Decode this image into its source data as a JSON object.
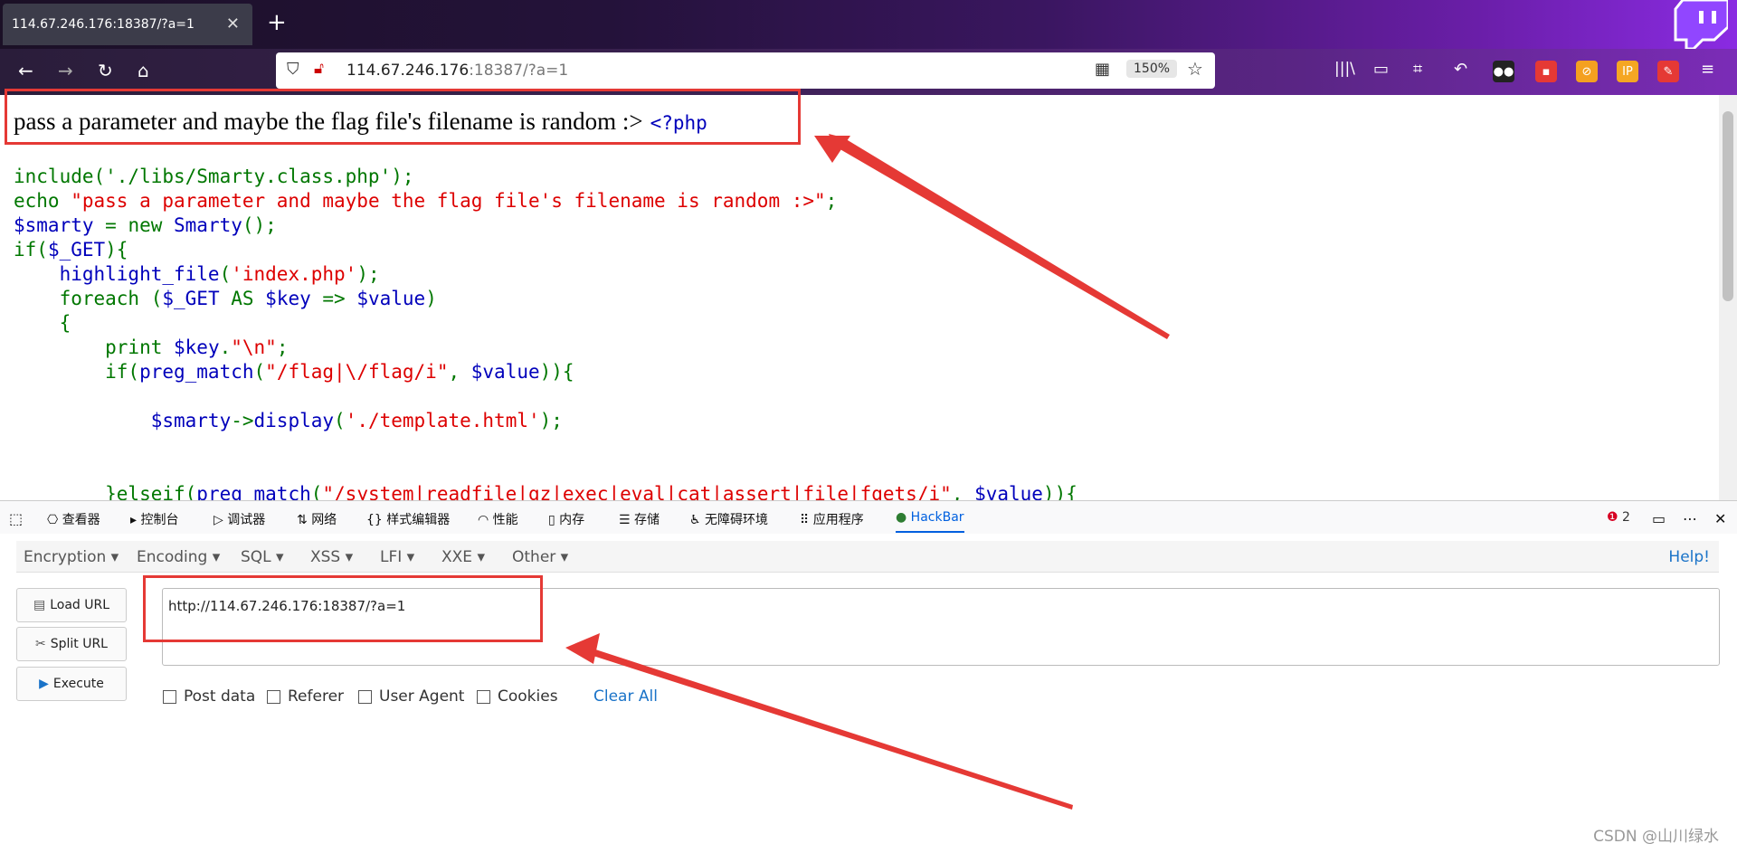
{
  "browser": {
    "tab_title": "114.67.246.176:18387/?a=1",
    "tab_close": "✕",
    "new_tab": "+",
    "url_host": "114.67.246.176",
    "url_rest": ":18387/?a=1",
    "zoom": "150%"
  },
  "page": {
    "echo_text": "pass a parameter and maybe the flag file's filename is random :>",
    "php_open": "<?php",
    "code_lines": [
      "include('./libs/Smarty.class.php');",
      "echo \"pass a parameter and maybe the flag file's filename is random :>\";",
      "$smarty = new Smarty();",
      "if($_GET){",
      "    highlight_file('index.php');",
      "    foreach ($_GET AS $key => $value)",
      "    {",
      "        print $key.\"\\n\";",
      "        if(preg_match(\"/flag|\\/flag/i\", $value)){",
      "",
      "            $smarty->display('./template.html');",
      "",
      "",
      "        }elseif(preg_match(\"/system|readfile|gz|exec|eval|cat|assert|file|fgets/i\", $value)){"
    ]
  },
  "devtools": {
    "tabs": [
      "查看器",
      "控制台",
      "调试器",
      "网络",
      "样式编辑器",
      "性能",
      "内存",
      "存储",
      "无障碍环境",
      "应用程序",
      "HackBar"
    ],
    "error_count": "2"
  },
  "hackbar": {
    "menus": [
      "Encryption",
      "Encoding",
      "SQL",
      "XSS",
      "LFI",
      "XXE",
      "Other"
    ],
    "help": "Help!",
    "buttons": [
      "Load URL",
      "Split URL",
      "Execute"
    ],
    "url_value": "http://114.67.246.176:18387/?a=1",
    "checkboxes": [
      "Post data",
      "Referer",
      "User Agent",
      "Cookies"
    ],
    "clear_all": "Clear All"
  },
  "watermark": "CSDN @山川绿水",
  "colors": {
    "annotation": "#e53935",
    "code_keyword": "#007700",
    "code_default": "#0000bb",
    "code_string": "#dd0000"
  }
}
